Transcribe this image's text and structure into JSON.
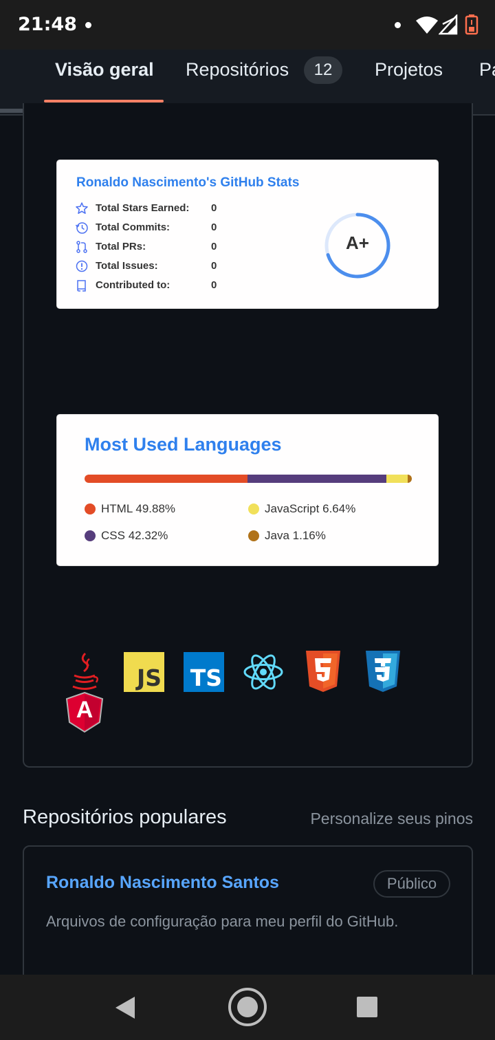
{
  "status_bar": {
    "time": "21:48",
    "icons": [
      "wifi-icon",
      "signal-icon",
      "battery-icon"
    ]
  },
  "tabs": [
    {
      "label": "Visão geral",
      "active": true
    },
    {
      "label": "Repositórios",
      "count": "12"
    },
    {
      "label": "Projetos"
    },
    {
      "label": "Pa"
    }
  ],
  "stats_card": {
    "title": "Ronaldo Nascimento's GitHub Stats",
    "rows": [
      {
        "icon": "star-icon",
        "label": "Total Stars Earned:",
        "value": "0"
      },
      {
        "icon": "history-icon",
        "label": "Total Commits:",
        "value": "0"
      },
      {
        "icon": "pull-request-icon",
        "label": "Total PRs:",
        "value": "0"
      },
      {
        "icon": "issue-icon",
        "label": "Total Issues:",
        "value": "0"
      },
      {
        "icon": "repo-icon",
        "label": "Contributed to:",
        "value": "0"
      }
    ],
    "rank": "A+",
    "rank_progress": 0.7
  },
  "languages_card": {
    "title": "Most Used Languages",
    "languages": [
      {
        "name": "HTML",
        "percent": "49.88%",
        "value": 49.88,
        "color": "#e34c26"
      },
      {
        "name": "CSS",
        "percent": "42.32%",
        "value": 42.32,
        "color": "#563d7c"
      },
      {
        "name": "JavaScript",
        "percent": "6.64%",
        "value": 6.64,
        "color": "#f1e05a"
      },
      {
        "name": "Java",
        "percent": "1.16%",
        "value": 1.16,
        "color": "#b07219"
      }
    ]
  },
  "tech_icons": [
    "java-icon",
    "javascript-icon",
    "typescript-icon",
    "react-icon",
    "html5-icon",
    "css3-icon",
    "angular-icon"
  ],
  "tech_labels": {
    "js": "JS",
    "ts": "TS",
    "angular": "A"
  },
  "popular": {
    "title": "Repositórios populares",
    "customize_link": "Personalize seus pinos",
    "repos": [
      {
        "name": "Ronaldo Nascimento Santos",
        "visibility": "Público",
        "description": "Arquivos de configuração para meu perfil do GitHub."
      }
    ]
  },
  "colors": {
    "accent": "#f78166",
    "link": "#58a6ff",
    "card_title": "#2f80ed"
  }
}
